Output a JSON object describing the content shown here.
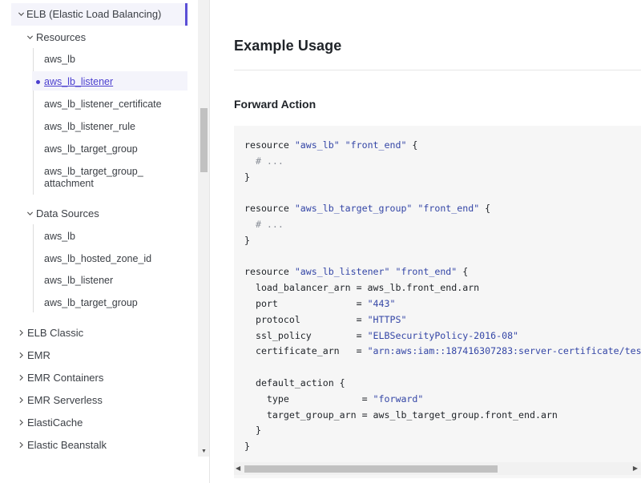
{
  "sidebar": {
    "active_section": "ELB (Elastic Load Balancing)",
    "resources_group": {
      "label": "Resources",
      "items": [
        {
          "label": "aws_lb"
        },
        {
          "label": "aws_lb_listener",
          "active": true
        },
        {
          "label": "aws_lb_listener_certificate"
        },
        {
          "label": "aws_lb_listener_rule"
        },
        {
          "label": "aws_lb_target_group"
        },
        {
          "label": "aws_lb_target_group_\nattachment"
        }
      ]
    },
    "data_sources_group": {
      "label": "Data Sources",
      "items": [
        {
          "label": "aws_lb"
        },
        {
          "label": "aws_lb_hosted_zone_id"
        },
        {
          "label": "aws_lb_listener"
        },
        {
          "label": "aws_lb_target_group"
        }
      ]
    },
    "sections": [
      {
        "label": "ELB Classic"
      },
      {
        "label": "EMR"
      },
      {
        "label": "EMR Containers"
      },
      {
        "label": "EMR Serverless"
      },
      {
        "label": "ElastiCache"
      },
      {
        "label": "Elastic Beanstalk"
      }
    ]
  },
  "main": {
    "heading": "Example Usage",
    "subheading": "Forward Action",
    "code_lines": [
      [
        [
          "k",
          "resource "
        ],
        [
          "s",
          "\"aws_lb\""
        ],
        [
          "k",
          " "
        ],
        [
          "s",
          "\"front_end\""
        ],
        [
          "k",
          " {"
        ]
      ],
      [
        [
          "c",
          "  # ..."
        ]
      ],
      [
        [
          "k",
          "}"
        ]
      ],
      [
        [
          "k",
          ""
        ]
      ],
      [
        [
          "k",
          "resource "
        ],
        [
          "s",
          "\"aws_lb_target_group\""
        ],
        [
          "k",
          " "
        ],
        [
          "s",
          "\"front_end\""
        ],
        [
          "k",
          " {"
        ]
      ],
      [
        [
          "c",
          "  # ..."
        ]
      ],
      [
        [
          "k",
          "}"
        ]
      ],
      [
        [
          "k",
          ""
        ]
      ],
      [
        [
          "k",
          "resource "
        ],
        [
          "s",
          "\"aws_lb_listener\""
        ],
        [
          "k",
          " "
        ],
        [
          "s",
          "\"front_end\""
        ],
        [
          "k",
          " {"
        ]
      ],
      [
        [
          "k",
          "  load_balancer_arn = aws_lb.front_end.arn"
        ]
      ],
      [
        [
          "k",
          "  port              = "
        ],
        [
          "s",
          "\"443\""
        ]
      ],
      [
        [
          "k",
          "  protocol          = "
        ],
        [
          "s",
          "\"HTTPS\""
        ]
      ],
      [
        [
          "k",
          "  ssl_policy        = "
        ],
        [
          "s",
          "\"ELBSecurityPolicy-2016-08\""
        ]
      ],
      [
        [
          "k",
          "  certificate_arn   = "
        ],
        [
          "s",
          "\"arn:aws:iam::187416307283:server-certificate/tes"
        ]
      ],
      [
        [
          "k",
          ""
        ]
      ],
      [
        [
          "k",
          "  default_action {"
        ]
      ],
      [
        [
          "k",
          "    type             = "
        ],
        [
          "s",
          "\"forward\""
        ]
      ],
      [
        [
          "k",
          "    target_group_arn = aws_lb_target_group.front_end.arn"
        ]
      ],
      [
        [
          "k",
          "  }"
        ]
      ],
      [
        [
          "k",
          "}"
        ]
      ]
    ]
  },
  "colors": {
    "accent": "#5b4fd6",
    "link_active": "#4b3fcf",
    "code_string": "#3446a6",
    "code_comment": "#8a8f98",
    "code_bg": "#f6f6f6"
  }
}
